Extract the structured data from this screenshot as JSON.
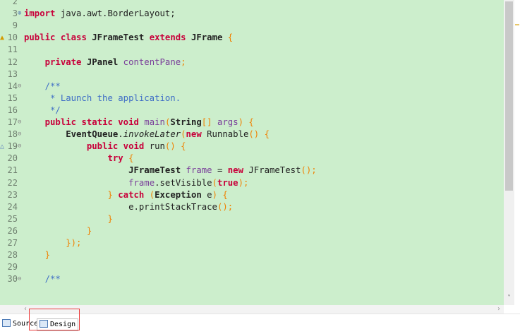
{
  "editor": {
    "lines": [
      {
        "num": "2",
        "fold": "",
        "marker": "",
        "tokens": []
      },
      {
        "num": "3",
        "fold": "+",
        "marker": "",
        "tokens": [
          {
            "t": "import",
            "c": "kw"
          },
          {
            "t": " java.awt.BorderLayout;",
            "c": ""
          }
        ]
      },
      {
        "num": "9",
        "fold": "",
        "marker": "",
        "tokens": []
      },
      {
        "num": "10",
        "fold": "",
        "marker": "warning",
        "tokens": [
          {
            "t": "public",
            "c": "kw"
          },
          {
            "t": " ",
            "c": ""
          },
          {
            "t": "class",
            "c": "kw"
          },
          {
            "t": " ",
            "c": ""
          },
          {
            "t": "JFrameTest",
            "c": "ty"
          },
          {
            "t": " ",
            "c": ""
          },
          {
            "t": "extends",
            "c": "kw"
          },
          {
            "t": " ",
            "c": ""
          },
          {
            "t": "JFrame",
            "c": "ty"
          },
          {
            "t": " {",
            "c": "pu"
          }
        ]
      },
      {
        "num": "11",
        "fold": "",
        "marker": "",
        "tokens": []
      },
      {
        "num": "12",
        "fold": "",
        "marker": "",
        "tokens": [
          {
            "t": "    ",
            "c": ""
          },
          {
            "t": "private",
            "c": "kw"
          },
          {
            "t": " ",
            "c": ""
          },
          {
            "t": "JPanel",
            "c": "ty"
          },
          {
            "t": " contentPane",
            "c": "fn"
          },
          {
            "t": ";",
            "c": "pu"
          }
        ]
      },
      {
        "num": "13",
        "fold": "",
        "marker": "",
        "tokens": []
      },
      {
        "num": "14",
        "fold": "-",
        "marker": "",
        "tokens": [
          {
            "t": "    /**",
            "c": "cm"
          }
        ]
      },
      {
        "num": "15",
        "fold": "",
        "marker": "",
        "tokens": [
          {
            "t": "     * Launch the application.",
            "c": "cm"
          }
        ]
      },
      {
        "num": "16",
        "fold": "",
        "marker": "",
        "tokens": [
          {
            "t": "     */",
            "c": "cm"
          }
        ]
      },
      {
        "num": "17",
        "fold": "-",
        "marker": "",
        "tokens": [
          {
            "t": "    ",
            "c": ""
          },
          {
            "t": "public",
            "c": "kw"
          },
          {
            "t": " ",
            "c": ""
          },
          {
            "t": "static",
            "c": "kw"
          },
          {
            "t": " ",
            "c": ""
          },
          {
            "t": "void",
            "c": "kw"
          },
          {
            "t": " ",
            "c": ""
          },
          {
            "t": "main",
            "c": "fn"
          },
          {
            "t": "(",
            "c": "pu"
          },
          {
            "t": "String",
            "c": "ty"
          },
          {
            "t": "[] ",
            "c": "pu"
          },
          {
            "t": "args",
            "c": "fn"
          },
          {
            "t": ") {",
            "c": "pu"
          }
        ]
      },
      {
        "num": "18",
        "fold": "-",
        "marker": "",
        "tokens": [
          {
            "t": "        ",
            "c": ""
          },
          {
            "t": "EventQueue",
            "c": "ty"
          },
          {
            "t": ".",
            "c": ""
          },
          {
            "t": "invokeLater",
            "c": "it"
          },
          {
            "t": "(",
            "c": "pu"
          },
          {
            "t": "new",
            "c": "kw"
          },
          {
            "t": " Runnable",
            "c": ""
          },
          {
            "t": "() {",
            "c": "pu"
          }
        ]
      },
      {
        "num": "19",
        "fold": "-",
        "marker": "override",
        "tokens": [
          {
            "t": "            ",
            "c": ""
          },
          {
            "t": "public",
            "c": "kw"
          },
          {
            "t": " ",
            "c": ""
          },
          {
            "t": "void",
            "c": "kw"
          },
          {
            "t": " run",
            "c": ""
          },
          {
            "t": "() {",
            "c": "pu"
          }
        ]
      },
      {
        "num": "20",
        "fold": "",
        "marker": "",
        "tokens": [
          {
            "t": "                ",
            "c": ""
          },
          {
            "t": "try",
            "c": "kw"
          },
          {
            "t": " {",
            "c": "pu"
          }
        ]
      },
      {
        "num": "21",
        "fold": "",
        "marker": "",
        "tokens": [
          {
            "t": "                    ",
            "c": ""
          },
          {
            "t": "JFrameTest",
            "c": "ty"
          },
          {
            "t": " frame",
            "c": "fn"
          },
          {
            "t": " = ",
            "c": ""
          },
          {
            "t": "new",
            "c": "kw"
          },
          {
            "t": " JFrameTest",
            "c": ""
          },
          {
            "t": "();",
            "c": "pu"
          }
        ]
      },
      {
        "num": "22",
        "fold": "",
        "marker": "",
        "tokens": [
          {
            "t": "                    ",
            "c": ""
          },
          {
            "t": "frame",
            "c": "fn"
          },
          {
            "t": ".setVisible",
            "c": ""
          },
          {
            "t": "(",
            "c": "pu"
          },
          {
            "t": "true",
            "c": "kw"
          },
          {
            "t": ");",
            "c": "pu"
          }
        ]
      },
      {
        "num": "23",
        "fold": "",
        "marker": "",
        "tokens": [
          {
            "t": "                ",
            "c": ""
          },
          {
            "t": "} ",
            "c": "pu"
          },
          {
            "t": "catch",
            "c": "kw"
          },
          {
            "t": " (",
            "c": "pu"
          },
          {
            "t": "Exception",
            "c": "ty"
          },
          {
            "t": " e",
            "c": ""
          },
          {
            "t": ") {",
            "c": "pu"
          }
        ]
      },
      {
        "num": "24",
        "fold": "",
        "marker": "",
        "tokens": [
          {
            "t": "                    ",
            "c": ""
          },
          {
            "t": "e.printStackTrace",
            "c": ""
          },
          {
            "t": "();",
            "c": "pu"
          }
        ]
      },
      {
        "num": "25",
        "fold": "",
        "marker": "",
        "tokens": [
          {
            "t": "                }",
            "c": "pu"
          }
        ]
      },
      {
        "num": "26",
        "fold": "",
        "marker": "",
        "tokens": [
          {
            "t": "            }",
            "c": "pu"
          }
        ]
      },
      {
        "num": "27",
        "fold": "",
        "marker": "",
        "tokens": [
          {
            "t": "        });",
            "c": "pu"
          }
        ]
      },
      {
        "num": "28",
        "fold": "",
        "marker": "",
        "tokens": [
          {
            "t": "    }",
            "c": "pu"
          }
        ]
      },
      {
        "num": "29",
        "fold": "",
        "marker": "",
        "tokens": []
      },
      {
        "num": "30",
        "fold": "-",
        "marker": "",
        "tokens": [
          {
            "t": "    /**",
            "c": "cm"
          }
        ]
      }
    ]
  },
  "tabs": {
    "source_label": "Source",
    "design_label": "Design"
  },
  "scrollbar": {
    "down_arrow": "˅",
    "left_arrow": "‹",
    "right_arrow": "›"
  },
  "colors": {
    "editor_background": "#cceecc",
    "keyword": "#c8003a",
    "comment": "#3f6ec6",
    "punctuation": "#f08000",
    "field": "#7a3f9a",
    "highlight_box": "#ea3b3b"
  }
}
